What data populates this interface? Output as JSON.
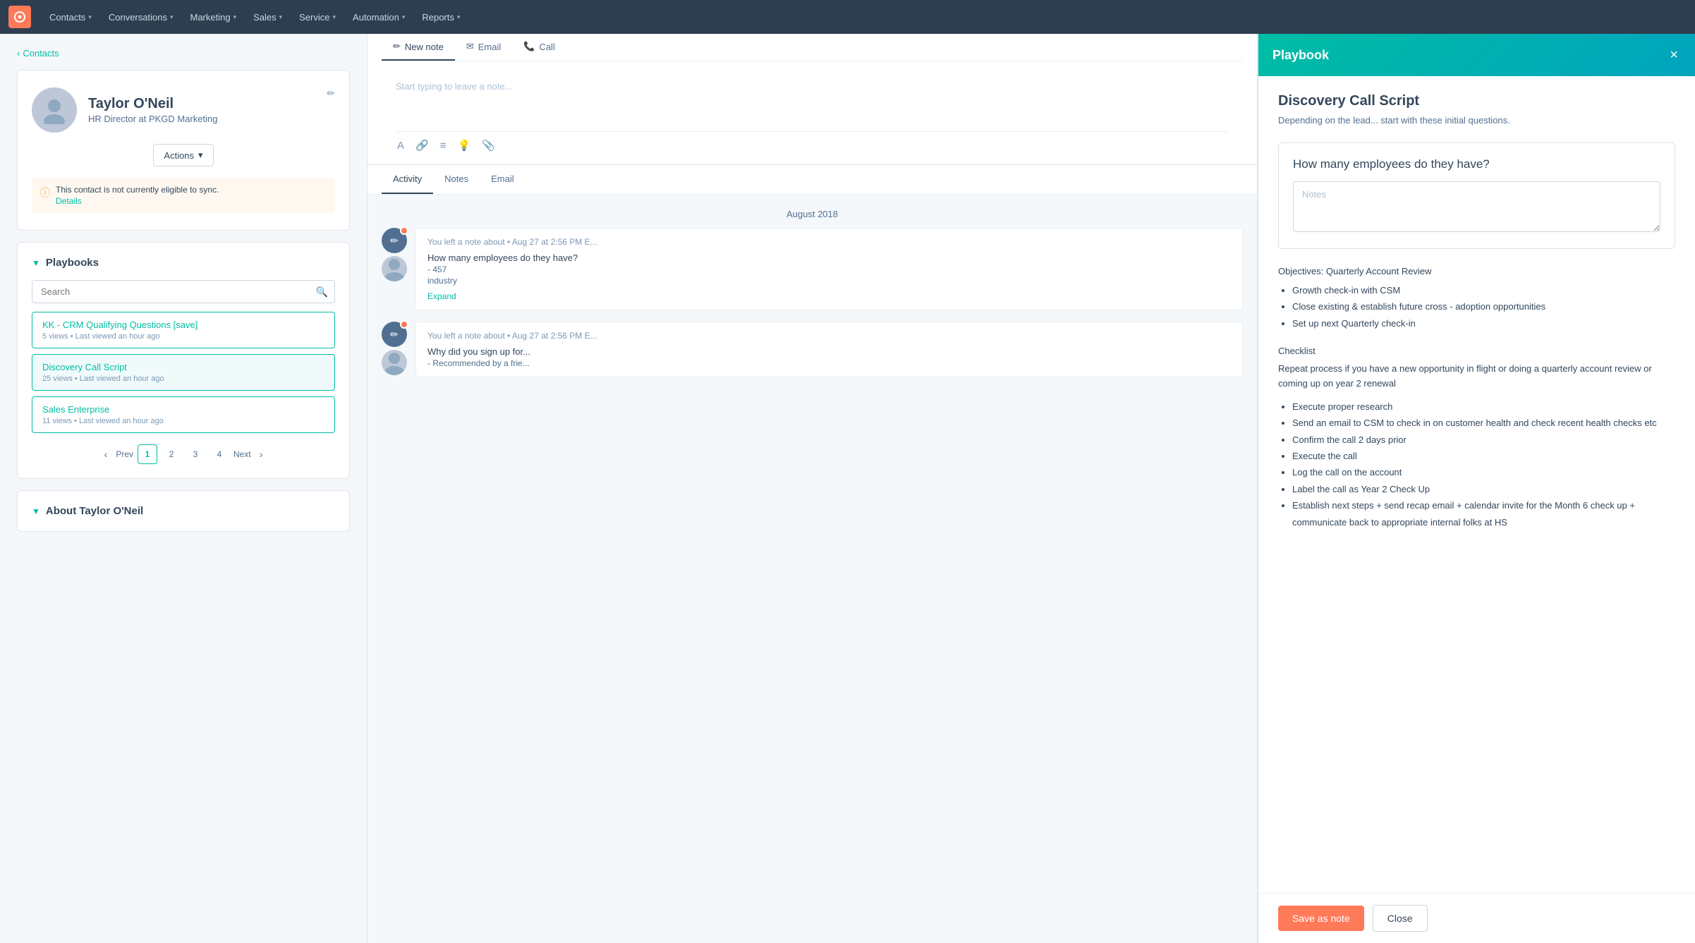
{
  "nav": {
    "items": [
      {
        "label": "Contacts",
        "id": "contacts"
      },
      {
        "label": "Conversations",
        "id": "conversations"
      },
      {
        "label": "Marketing",
        "id": "marketing"
      },
      {
        "label": "Sales",
        "id": "sales"
      },
      {
        "label": "Service",
        "id": "service"
      },
      {
        "label": "Automation",
        "id": "automation"
      },
      {
        "label": "Reports",
        "id": "reports"
      }
    ]
  },
  "breadcrumb": "Contacts",
  "contact": {
    "name": "Taylor O'Neil",
    "title": "HR Director at PKGD Marketing",
    "actions_label": "Actions",
    "sync_warning": "This contact is not currently eligible to sync.",
    "details_link": "Details"
  },
  "playbooks": {
    "section_title": "Playbooks",
    "search_placeholder": "Search",
    "items": [
      {
        "title": "KK - CRM Qualifying Questions [save]",
        "meta": "5 views • Last viewed an hour ago"
      },
      {
        "title": "Discovery Call Script",
        "meta": "25 views • Last viewed an hour ago"
      },
      {
        "title": "Sales Enterprise",
        "meta": "11 views • Last viewed an hour ago"
      }
    ],
    "pagination": {
      "prev_label": "Prev",
      "next_label": "Next",
      "pages": [
        "1",
        "2",
        "3",
        "4"
      ],
      "active": "1"
    }
  },
  "about_section": {
    "title": "About Taylor O'Neil"
  },
  "compose_tabs": [
    {
      "label": "New note",
      "icon": "✏",
      "active": true
    },
    {
      "label": "Email",
      "icon": "✉"
    },
    {
      "label": "Call",
      "icon": "📞"
    }
  ],
  "note_placeholder": "Start typing to leave a note...",
  "activity_tabs": [
    {
      "label": "Activity",
      "active": true
    },
    {
      "label": "Notes"
    },
    {
      "label": "Email"
    }
  ],
  "date_divider": "August 2018",
  "activity_items": [
    {
      "header": "You left a note about • Aug 27 at 2:56 PM E...",
      "lines": [
        "How many employees do they have?",
        "- 457",
        "industry"
      ],
      "expand": "Expand"
    },
    {
      "header": "You left a note about • Aug 27 at 2:56 PM E...",
      "lines": [
        "Why did you sign up for...",
        "- Recommended by a frie..."
      ]
    }
  ],
  "playbook_panel": {
    "header_title": "Playbook",
    "close_label": "×",
    "title": "Discovery Call Script",
    "description": "Depending on the lead... start with these initial questions.",
    "question": "How many employees do they have?",
    "notes_placeholder": "Notes",
    "objectives_label": "Objectives: Quarterly Account Review",
    "objectives_items": [
      "Growth check-in with CSM",
      "Close existing & establish future cross - adoption opportunities",
      "Set up next Quarterly check-in"
    ],
    "checklist_label": "Checklist",
    "checklist_intro": "Repeat process if you have a new opportunity in flight or doing a quarterly account review or coming up on year 2 renewal",
    "checklist_items": [
      "Execute proper research",
      "Send an email to CSM to check in on customer health and check recent health checks etc",
      "Confirm the call 2 days prior",
      "Execute the call",
      "Log the call on the account",
      "Label the call as Year 2 Check Up",
      "Establish next steps + send recap email + calendar invite for the Month 6 check up + communicate back to appropriate internal folks at HS"
    ],
    "save_note_label": "Save as note",
    "close_btn_label": "Close"
  }
}
